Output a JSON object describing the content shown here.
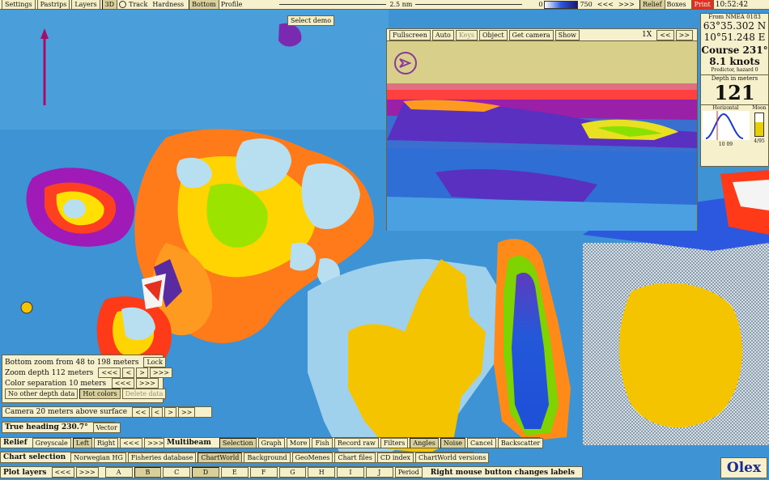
{
  "topbar": {
    "settings": "Settings",
    "pastrips": "Pastrips",
    "layers": "Layers",
    "mode3d": "3D",
    "track": "Track",
    "hardness": "Hardness",
    "bottom": "Bottom",
    "profile": "Profile",
    "scale": "2.5 nm",
    "depth_min": "0",
    "depth_max": "750",
    "nav_left": "<<<",
    "nav_right": ">>>",
    "relief": "Relief",
    "boxes": "Boxes",
    "print": "Print",
    "clock": "10:52:42"
  },
  "select_demo": "Select demo",
  "view3d": {
    "buttons": [
      "Fullscreen",
      "Auto",
      "Keys",
      "Object",
      "Get camera",
      "Show"
    ],
    "zoom": "1X",
    "prev": "<<",
    "next": ">>"
  },
  "nav": {
    "header": "From NMEA 0183",
    "lat": "63°35.302 N",
    "lon": "10°51.248 E",
    "course": "Course 231°",
    "speed": "8.1 knots",
    "status": "Predictor, hazard 0",
    "depth_label": "Depth in meters",
    "depth_value": "121",
    "horizon_label": "Horizontal",
    "moon_label": "Moon",
    "scale_values": [
      "3.0",
      "1.0",
      "0.0"
    ],
    "time_range": "10   09",
    "moon_value": "4/95"
  },
  "left_panel": {
    "bottom_zoom": "Bottom zoom from 48 to 198 meters",
    "lock": "Lock",
    "zoom_depth": "Zoom depth 112 meters",
    "color_sep": "Color separation 10 meters",
    "no_other": "No other depth data",
    "hot_colors": "Hot colors",
    "delete_data": "Delete data",
    "arrows": [
      "<<<",
      "<",
      ">",
      ">>>"
    ]
  },
  "camera": {
    "label": "Camera 20 meters above surface",
    "arrows": [
      "<<",
      "<",
      ">",
      ">>"
    ]
  },
  "heading": {
    "label": "True heading 230.7°",
    "button": "Vector"
  },
  "relief_bar": {
    "label": "Relief",
    "buttons": [
      "Greyscale",
      "Left",
      "Right",
      "<<<",
      ">>>"
    ]
  },
  "multibeam": {
    "label": "Multibeam",
    "buttons": [
      "Selection",
      "Graph",
      "More",
      "Fish",
      "Record raw",
      "Filters",
      "Angles",
      "Noise",
      "Cancel",
      "Backscatter"
    ]
  },
  "chart_selection": {
    "label": "Chart selection",
    "buttons": [
      "Norwegian HG",
      "Fisheries database",
      "ChartWorld",
      "Background",
      "GeoMenes",
      "Chart files",
      "CD index",
      "ChartWorld versions"
    ]
  },
  "plot_layers": {
    "label": "Plot layers",
    "nav": [
      "<<<",
      ">>>"
    ],
    "letters": [
      "A",
      "B",
      "C",
      "D",
      "E",
      "F",
      "G",
      "H",
      "I",
      "J"
    ],
    "period": "Period",
    "hint": "Right mouse button changes labels"
  },
  "brand": "Olex",
  "colors": {
    "panel_bg": "#f6f0cc",
    "border": "#6b6340",
    "land": "#f5c400",
    "deep": "#2c58e0",
    "shallow": "#e53020"
  }
}
